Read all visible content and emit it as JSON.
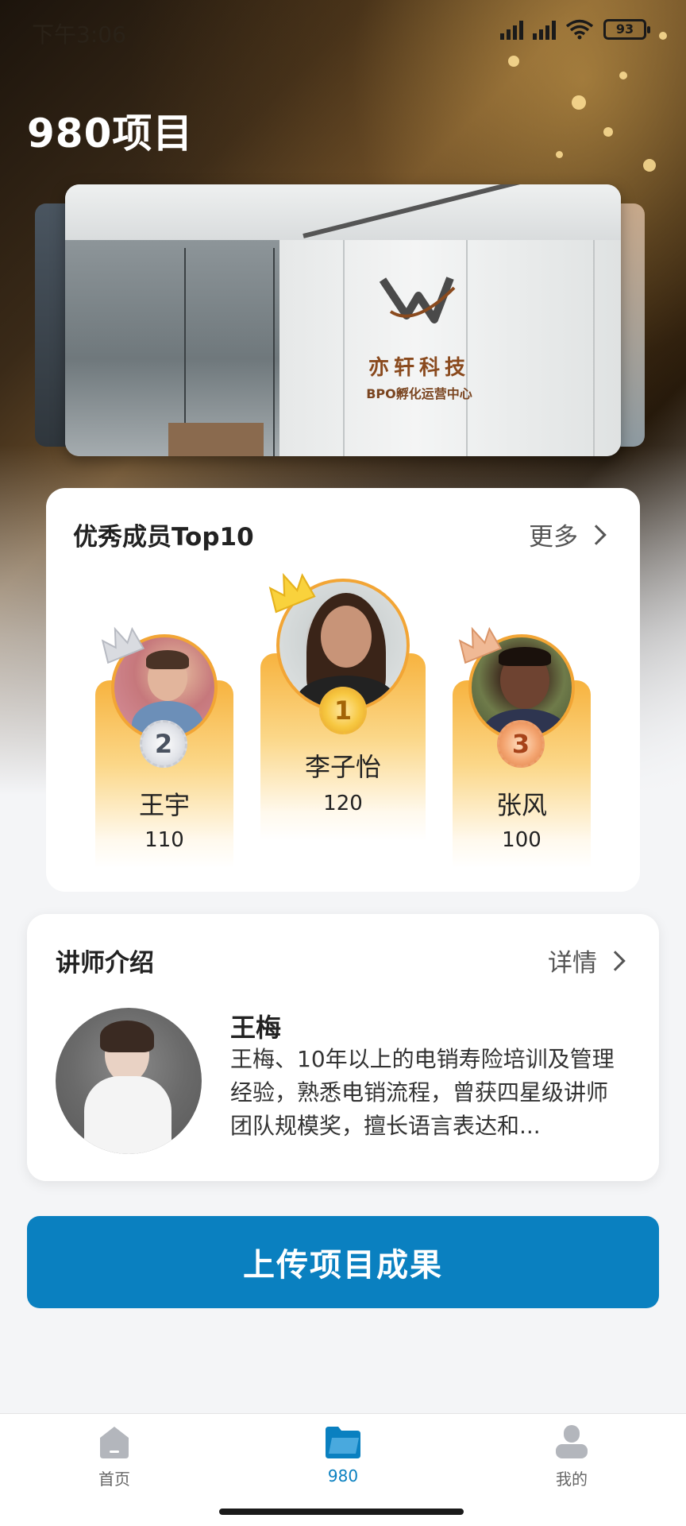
{
  "status_bar": {
    "time": "下午3:06",
    "battery": "93",
    "signal_1": "HD",
    "signal_2": "HD"
  },
  "page": {
    "title": "980项目"
  },
  "banner": {
    "company_name": "亦轩科技",
    "subtitle": "BPO孵化运营中心"
  },
  "top10": {
    "title": "优秀成员Top10",
    "more_label": "更多",
    "members": [
      {
        "rank": "2",
        "name": "王宇",
        "score": "110",
        "medal": "silver"
      },
      {
        "rank": "1",
        "name": "李子怡",
        "score": "120",
        "medal": "gold"
      },
      {
        "rank": "3",
        "name": "张风",
        "score": "100",
        "medal": "bronze"
      }
    ]
  },
  "lecturer": {
    "title": "讲师介绍",
    "detail_label": "详情",
    "name": "王梅",
    "description": "王梅、10年以上的电销寿险培训及管理经验，熟悉电销流程，曾获四星级讲师团队规模奖，擅长语言表达和..."
  },
  "upload_button": {
    "label": "上传项目成果"
  },
  "tab_bar": {
    "tabs": [
      {
        "label": "首页",
        "icon": "home-icon",
        "active": false
      },
      {
        "label": "980",
        "icon": "folder-icon",
        "active": true
      },
      {
        "label": "我的",
        "icon": "user-icon",
        "active": false
      }
    ]
  },
  "colors": {
    "accent": "#0a80c0",
    "podium": "#f7b33f",
    "gold_border": "#f2a535"
  }
}
